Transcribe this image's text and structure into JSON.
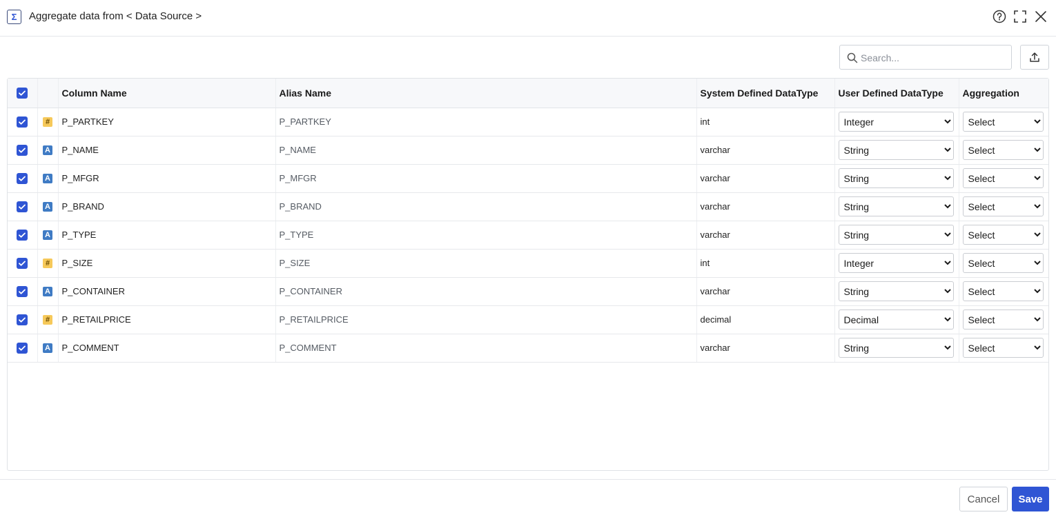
{
  "header": {
    "title": "Aggregate data from < Data Source >",
    "app_icon_glyph": "Σ"
  },
  "toolbar": {
    "search_placeholder": "Search..."
  },
  "table": {
    "columns": [
      "Column Name",
      "Alias Name",
      "System Defined DataType",
      "User Defined DataType",
      "Aggregation"
    ],
    "rows": [
      {
        "kind": "number",
        "type_glyph": "#",
        "name": "P_PARTKEY",
        "alias": "P_PARTKEY",
        "sys_type": "int",
        "user_type": "Integer",
        "aggregation": "Select"
      },
      {
        "kind": "string",
        "type_glyph": "A",
        "name": "P_NAME",
        "alias": "P_NAME",
        "sys_type": "varchar",
        "user_type": "String",
        "aggregation": "Select"
      },
      {
        "kind": "string",
        "type_glyph": "A",
        "name": "P_MFGR",
        "alias": "P_MFGR",
        "sys_type": "varchar",
        "user_type": "String",
        "aggregation": "Select"
      },
      {
        "kind": "string",
        "type_glyph": "A",
        "name": "P_BRAND",
        "alias": "P_BRAND",
        "sys_type": "varchar",
        "user_type": "String",
        "aggregation": "Select"
      },
      {
        "kind": "string",
        "type_glyph": "A",
        "name": "P_TYPE",
        "alias": "P_TYPE",
        "sys_type": "varchar",
        "user_type": "String",
        "aggregation": "Select"
      },
      {
        "kind": "number",
        "type_glyph": "#",
        "name": "P_SIZE",
        "alias": "P_SIZE",
        "sys_type": "int",
        "user_type": "Integer",
        "aggregation": "Select"
      },
      {
        "kind": "string",
        "type_glyph": "A",
        "name": "P_CONTAINER",
        "alias": "P_CONTAINER",
        "sys_type": "varchar",
        "user_type": "String",
        "aggregation": "Select"
      },
      {
        "kind": "number",
        "type_glyph": "#",
        "name": "P_RETAILPRICE",
        "alias": "P_RETAILPRICE",
        "sys_type": "decimal",
        "user_type": "Decimal",
        "aggregation": "Select"
      },
      {
        "kind": "string",
        "type_glyph": "A",
        "name": "P_COMMENT",
        "alias": "P_COMMENT",
        "sys_type": "varchar",
        "user_type": "String",
        "aggregation": "Select"
      }
    ]
  },
  "footer": {
    "cancel_label": "Cancel",
    "save_label": "Save"
  },
  "colors": {
    "accent": "#2f55d4",
    "number_icon": "#f6c95a",
    "string_icon": "#3f7bc4"
  },
  "icons": {
    "header_right": [
      "help-icon",
      "fullscreen-icon",
      "close-icon"
    ],
    "search": "search-icon",
    "upload": "upload-icon"
  }
}
